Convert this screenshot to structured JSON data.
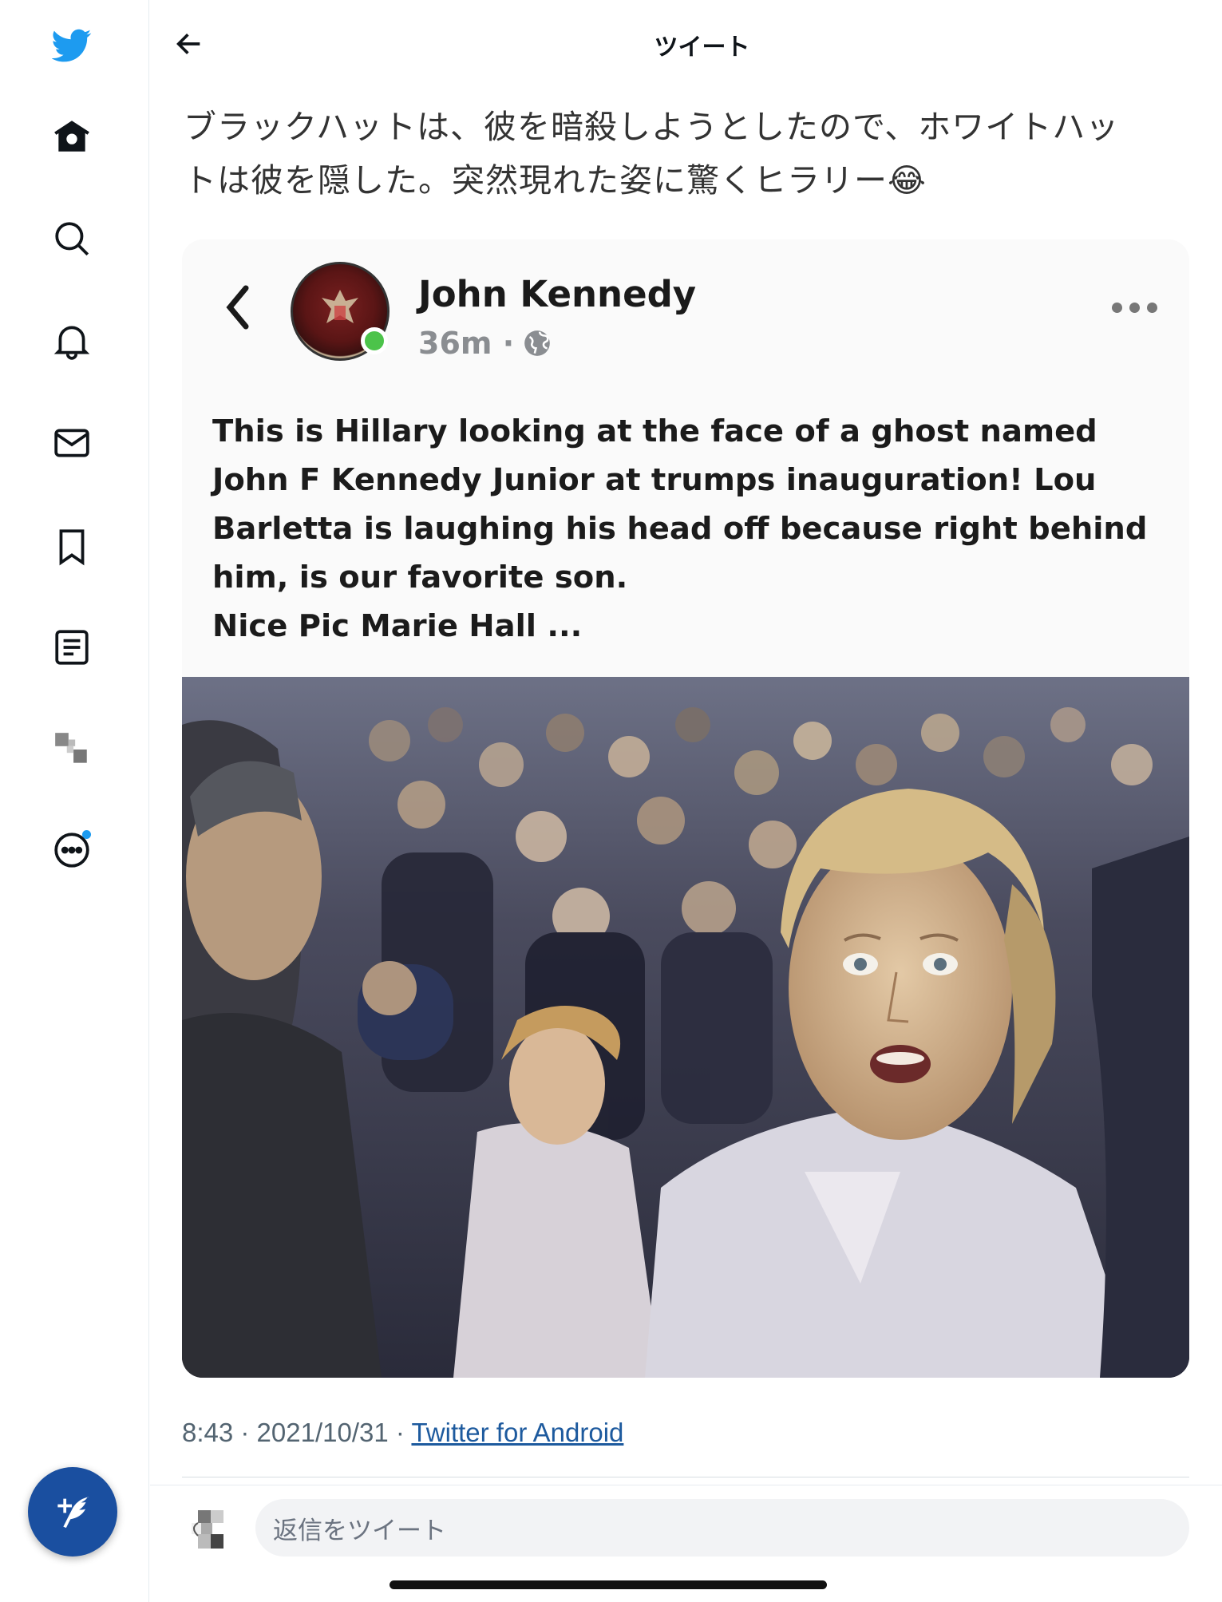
{
  "sidebar": {
    "items": [
      {
        "name": "twitter-logo-icon",
        "color": "#1d9bf0"
      },
      {
        "name": "home-icon"
      },
      {
        "name": "search-icon"
      },
      {
        "name": "bell-icon"
      },
      {
        "name": "mail-icon"
      },
      {
        "name": "bookmark-icon"
      },
      {
        "name": "list-icon"
      },
      {
        "name": "pixelated-avatar-icon"
      },
      {
        "name": "more-icon"
      }
    ],
    "compose_color": "#1a4fa0"
  },
  "header": {
    "title": "ツイート"
  },
  "tweet": {
    "text_line1": "ブラックハットは、彼を暗殺しようとしたので、ホワイトハッ",
    "text_line2": "トは彼を隠した。突然現れた姿に驚くヒラリー😂",
    "timestamp": "8:43 · 2021/10/31 · ",
    "source": "Twitter for Android"
  },
  "embedded_post": {
    "author": "John Kennedy",
    "time": "36m ·",
    "body_lines": [
      "This is Hillary looking at the face of a ghost named",
      "John F Kennedy Junior at trumps inauguration! Lou",
      "Barletta is laughing his head off because right behind",
      "him, is our favorite son.",
      "Nice Pic Marie Hall ..."
    ]
  },
  "reply": {
    "placeholder": "返信をツイート"
  }
}
